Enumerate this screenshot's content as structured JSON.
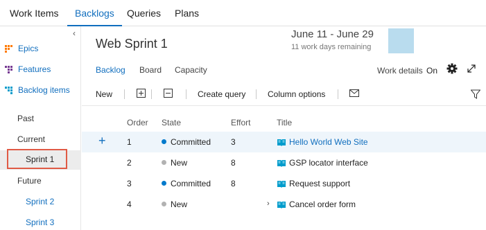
{
  "topnav": {
    "tabs": [
      {
        "label": "Work Items"
      },
      {
        "label": "Backlogs"
      },
      {
        "label": "Queries"
      },
      {
        "label": "Plans"
      }
    ]
  },
  "sidebar": {
    "backlogs": [
      {
        "label": "Epics",
        "icon": "epics-backlog-icon",
        "color": "#ff7b00"
      },
      {
        "label": "Features",
        "icon": "features-backlog-icon",
        "color": "#773b93"
      },
      {
        "label": "Backlog items",
        "icon": "backlog-items-icon",
        "color": "#009ccc"
      }
    ],
    "iterations": {
      "past": "Past",
      "current": "Current",
      "selected": "Sprint 1",
      "future": "Future",
      "future_items": [
        "Sprint 2",
        "Sprint 3"
      ]
    }
  },
  "header": {
    "sprint_title": "Web Sprint 1",
    "date_range": "June 11 - June 29",
    "work_remaining": "11 work days remaining"
  },
  "pivots": {
    "backlog": "Backlog",
    "board": "Board",
    "capacity": "Capacity"
  },
  "work_details": {
    "label": "Work details",
    "state": "On"
  },
  "toolbar": {
    "new_label": "New",
    "create_query_label": "Create query",
    "column_options_label": "Column options"
  },
  "grid": {
    "columns": {
      "order": "Order",
      "state": "State",
      "effort": "Effort",
      "title": "Title"
    },
    "rows": [
      {
        "order": "1",
        "state": "Committed",
        "state_color": "#007acc",
        "effort": "3",
        "title": "Hello World Web Site"
      },
      {
        "order": "2",
        "state": "New",
        "state_color": "#b2b2b2",
        "effort": "8",
        "title": "GSP locator interface"
      },
      {
        "order": "3",
        "state": "Committed",
        "state_color": "#007acc",
        "effort": "8",
        "title": "Request support"
      },
      {
        "order": "4",
        "state": "New",
        "state_color": "#b2b2b2",
        "effort": "",
        "title": "Cancel order form"
      }
    ]
  },
  "colors": {
    "accent": "#106ebe",
    "selection_outline": "#e05a45",
    "book_icon": "#009ccc"
  }
}
